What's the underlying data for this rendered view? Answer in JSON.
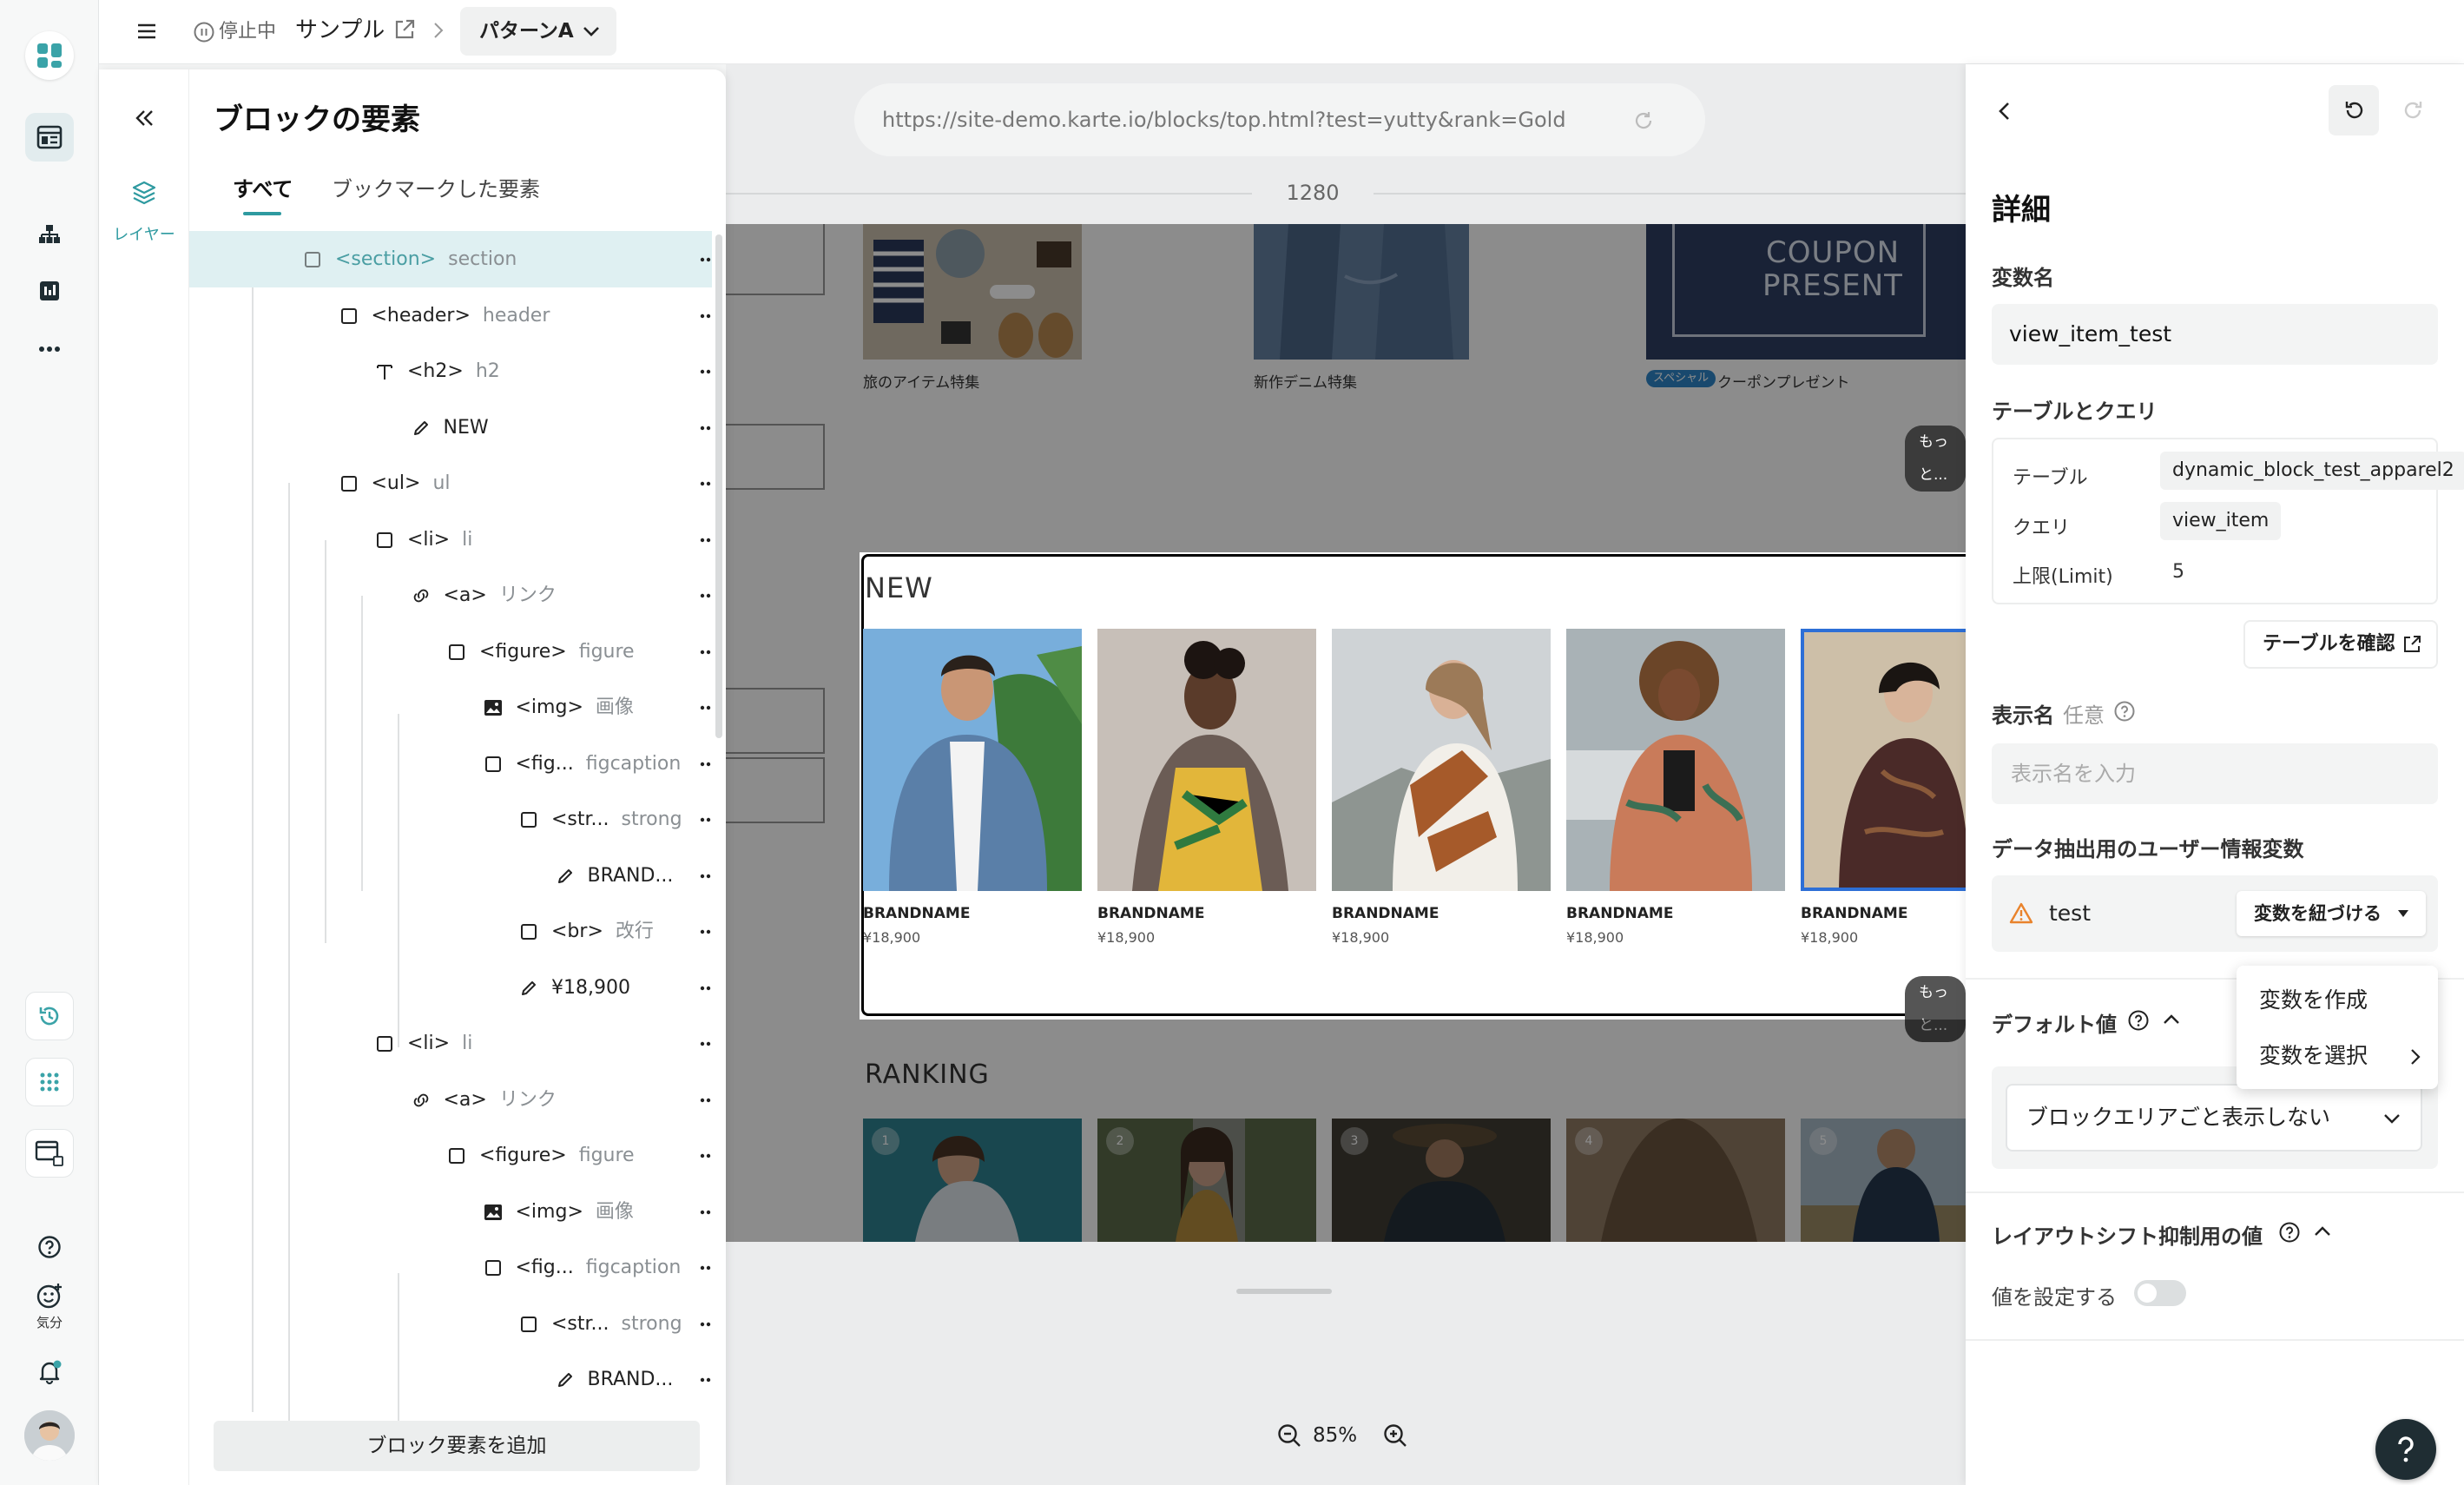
{
  "topbar": {
    "status": "停止中",
    "site_name": "サンプル",
    "pattern": "パターンA"
  },
  "rail": {
    "mood_label": "気分"
  },
  "layer_panel": {
    "title": "ブロックの要素",
    "side_label": "レイヤー",
    "tabs": [
      {
        "label": "すべて",
        "active": true
      },
      {
        "label": "ブックマークした要素",
        "active": false
      }
    ],
    "add_button": "ブロック要素を追加",
    "rows": [
      {
        "tag": "<section>",
        "kind": "section",
        "icon": "box-icon",
        "depth": 0,
        "bookmarked": false,
        "selected": true
      },
      {
        "tag": "<header>",
        "kind": "header",
        "icon": "box-icon",
        "depth": 1,
        "bookmarked": false
      },
      {
        "tag": "<h2>",
        "kind": "h2",
        "icon": "text-icon",
        "depth": 2,
        "bookmarked": false
      },
      {
        "tag": "NEW",
        "kind": "",
        "icon": "pencil-icon",
        "depth": 3,
        "bookmarked": true
      },
      {
        "tag": "<ul>",
        "kind": "ul",
        "icon": "box-icon",
        "depth": 1,
        "bookmarked": false
      },
      {
        "tag": "<li>",
        "kind": "li",
        "icon": "box-icon",
        "depth": 2,
        "bookmarked": false
      },
      {
        "tag": "<a>",
        "kind": "リンク",
        "icon": "link-icon",
        "depth": 3,
        "bookmarked": true
      },
      {
        "tag": "<figure>",
        "kind": "figure",
        "icon": "box-icon",
        "depth": 4,
        "bookmarked": false
      },
      {
        "tag": "<img>",
        "kind": "画像",
        "icon": "image-icon",
        "depth": 5,
        "bookmarked": true
      },
      {
        "tag": "<fig...",
        "kind": "figcaption",
        "icon": "box-icon",
        "depth": 5,
        "bookmarked": false
      },
      {
        "tag": "<str...",
        "kind": "strong",
        "icon": "box-icon",
        "depth": 6,
        "bookmarked": false
      },
      {
        "tag": "BRAND...",
        "kind": "",
        "icon": "pencil-icon",
        "depth": 7,
        "bookmarked": true
      },
      {
        "tag": "<br>",
        "kind": "改行",
        "icon": "box-icon",
        "depth": 6,
        "bookmarked": false
      },
      {
        "tag": "¥18,900",
        "kind": "",
        "icon": "pencil-icon",
        "depth": 6,
        "bookmarked": true
      },
      {
        "tag": "<li>",
        "kind": "li",
        "icon": "box-icon",
        "depth": 2,
        "bookmarked": false
      },
      {
        "tag": "<a>",
        "kind": "リンク",
        "icon": "link-icon",
        "depth": 3,
        "bookmarked": true
      },
      {
        "tag": "<figure>",
        "kind": "figure",
        "icon": "box-icon",
        "depth": 4,
        "bookmarked": false
      },
      {
        "tag": "<img>",
        "kind": "画像",
        "icon": "image-icon",
        "depth": 5,
        "bookmarked": true
      },
      {
        "tag": "<fig...",
        "kind": "figcaption",
        "icon": "box-icon",
        "depth": 5,
        "bookmarked": false
      },
      {
        "tag": "<str...",
        "kind": "strong",
        "icon": "box-icon",
        "depth": 6,
        "bookmarked": false
      },
      {
        "tag": "BRAND...",
        "kind": "",
        "icon": "pencil-icon",
        "depth": 7,
        "bookmarked": true
      }
    ]
  },
  "preview": {
    "url": "https://site-demo.karte.io/blocks/top.html?test=yutty&rank=Gold",
    "width_label": "1280",
    "zoom": "85%",
    "more_label": "もっと...",
    "top_banners": [
      "旅のアイテム特集",
      "新作デニム特集",
      "クーポンプレゼント"
    ],
    "special_badge": "スペシャル",
    "coupon_text": [
      "COUPON",
      "PRESENT"
    ],
    "new_title": "NEW",
    "ranking_title": "RANKING",
    "products": [
      {
        "brand": "BRANDNAME",
        "price": "¥18,900"
      },
      {
        "brand": "BRANDNAME",
        "price": "¥18,900"
      },
      {
        "brand": "BRANDNAME",
        "price": "¥18,900"
      },
      {
        "brand": "BRANDNAME",
        "price": "¥18,900"
      },
      {
        "brand": "BRANDNAME",
        "price": "¥18,900"
      }
    ],
    "ranks": [
      "1",
      "2",
      "3",
      "4",
      "5"
    ]
  },
  "detail": {
    "title": "詳細",
    "var_name_label": "変数名",
    "var_name_value": "view_item_test",
    "table_query_label": "テーブルとクエリ",
    "table_key": "テーブル",
    "table_value": "dynamic_block_test_apparel2",
    "query_key": "クエリ",
    "query_value": "view_item",
    "limit_key": "上限(Limit)",
    "limit_value": "5",
    "check_table_button": "テーブルを確認",
    "display_name_label": "表示名",
    "display_name_optional": "任意",
    "display_name_placeholder": "表示名を入力",
    "user_var_label": "データ抽出用のユーザー情報変数",
    "user_var_value": "test",
    "link_var_button": "変数を紐づける",
    "menu": [
      "変数を作成",
      "変数を選択"
    ],
    "default_label": "デフォルト値",
    "default_select": "ブロックエリアごと表示しない",
    "layout_shift_label": "レイアウトシフト抑制用の値",
    "set_value_label": "値を設定する",
    "set_value_on": false
  },
  "colors": {
    "accent": "#2e9aa0",
    "selected_row": "#dff0f2",
    "warning": "#e9832c",
    "focus_border": "#2d6fd6"
  }
}
